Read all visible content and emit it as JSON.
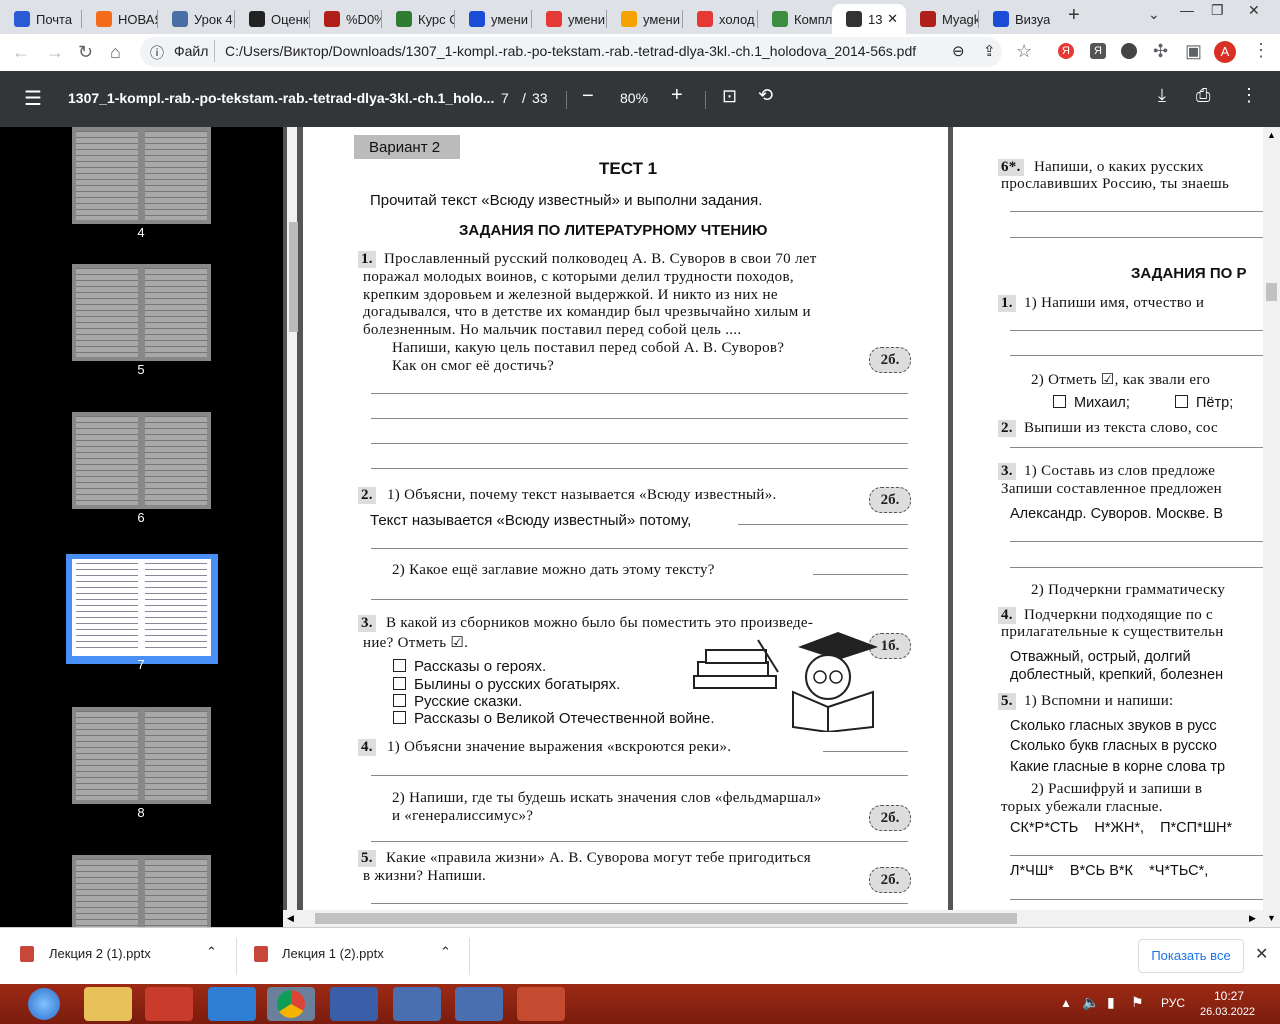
{
  "tabs": [
    {
      "title": "Почта",
      "color": "#2a5bd7",
      "icon": "mail-icon"
    },
    {
      "title": "НОВАЯ",
      "color": "#f66b1c",
      "icon": "site-icon"
    },
    {
      "title": "Урок 4",
      "color": "#4a6fa5",
      "icon": "site-icon"
    },
    {
      "title": "Оценк",
      "color": "#222222",
      "icon": "site-icon"
    },
    {
      "title": "%D0%",
      "color": "#b0201b",
      "icon": "pdf-icon"
    },
    {
      "title": "Курс С",
      "color": "#2e7d32",
      "icon": "site-icon"
    },
    {
      "title": "умени",
      "color": "#1a4cd6",
      "icon": "search-icon"
    },
    {
      "title": "умени",
      "color": "#e53935",
      "icon": "yandex-icon"
    },
    {
      "title": "умени",
      "color": "#f4a300",
      "icon": "image-icon"
    },
    {
      "title": "холод",
      "color": "#e53935",
      "icon": "yandex-icon"
    },
    {
      "title": "Компл",
      "color": "#3e8e41",
      "icon": "book-icon"
    },
    {
      "title": "13",
      "color": "#333333",
      "icon": "globe-icon",
      "active": true
    },
    {
      "title": "Myagk",
      "color": "#b0201b",
      "icon": "pdf-icon"
    },
    {
      "title": "Визуа",
      "color": "#1a4cd6",
      "icon": "site-icon"
    }
  ],
  "address": {
    "scheme": "Файл",
    "url": "C:/Users/Виктор/Downloads/1307_1-kompl.-rab.-po-tekstam.-rab.-tetrad-dlya-3kl.-ch.1_holodova_2014-56s.pdf",
    "avatar": "A"
  },
  "pdf": {
    "title": "1307_1-kompl.-rab.-po-tekstam.-rab.-tetrad-dlya-3kl.-ch.1_holo...",
    "page": "7",
    "page_sep": "/",
    "total": "33",
    "zoom": "80%"
  },
  "thumbs": [
    {
      "num": "4"
    },
    {
      "num": "5"
    },
    {
      "num": "6"
    },
    {
      "num": "7",
      "selected": true
    },
    {
      "num": "8"
    },
    {
      "num": ""
    }
  ],
  "page1": {
    "variant": "Вариант 2",
    "test": "ТЕСТ 1",
    "intro": "Прочитай текст «Всюду известный» и выполни задания.",
    "section": "ЗАДАНИЯ ПО ЛИТЕРАТУРНОМУ ЧТЕНИЮ",
    "q1_num": "1.",
    "q1_lines": [
      "Прославленный русский полководец А. В. Суворов в свои 70 лет",
      "поражал молодых воинов, с которыми делил трудности походов,",
      "крепким здоровьем и железной выдержкой. И никто из них не",
      "догадывался, что в детстве их командир был чрезвычайно хилым и",
      "болезненным. Но мальчик поставил перед собой цель ...."
    ],
    "q1_task": [
      "Напиши, какую цель поставил перед собой А. В. Суворов?",
      "Как он смог её достичь?"
    ],
    "q1_pts": "2б.",
    "q2_num": "2.",
    "q2_a": "1) Объясни, почему текст называется «Всюду известный».",
    "q2_pts": "2б.",
    "q2_ans": "Текст называется «Всюду известный» потому,",
    "q2_b": "2) Какое ещё заглавие можно дать этому тексту?",
    "q3_num": "3.",
    "q3_lines": [
      "В какой из сборников можно было бы поместить это произведе-",
      "ние? Отметь ☑."
    ],
    "q3_pts": "1б.",
    "q3_options": [
      "Рассказы о героях.",
      "Былины о русских богатырях.",
      "Русские сказки.",
      "Рассказы о Великой Отечественной войне."
    ],
    "q4_num": "4.",
    "q4_a": "1) Объясни значение выражения «вскроются реки».",
    "q4_b": [
      "2) Напиши, где ты будешь искать значения слов «фельдмаршал»",
      "и «генералиссимус»?"
    ],
    "q4_pts": "2б.",
    "q5_num": "5.",
    "q5_lines": [
      "Какие «правила жизни» А. В. Суворова могут тебе пригодиться",
      "в жизни? Напиши."
    ],
    "q5_pts": "2б."
  },
  "page2": {
    "q6_num": "6*.",
    "q6_lines": [
      "Напиши, о каких русских",
      "прославивших Россию, ты знаешь"
    ],
    "section": "ЗАДАНИЯ ПО Р",
    "q1": "1) Напиши имя, отчество и",
    "q1_b": "2) Отметь ☑, как звали его",
    "q1_opts": [
      "Михаил;",
      "Пётр;"
    ],
    "q2": "Выпиши из текста слово, сос",
    "q3": [
      "1) Составь из слов предложе",
      "Запиши составленное предложен"
    ],
    "q3_words": "Александр. Суворов. Москве. В",
    "q3_b": "2) Подчеркни грамматическу",
    "q4": [
      "Подчеркни подходящие по с",
      "прилагательные к существительн"
    ],
    "q4_words": [
      "Отважный, острый, долгий",
      "доблестный, крепкий, болезнен"
    ],
    "q5": "1) Вспомни и напиши:",
    "q5_lines": [
      "Сколько гласных звуков в русс",
      "Сколько букв гласных в русско",
      "Какие гласные в корне слова тр"
    ],
    "q5_b": [
      "2) Расшифруй и запиши в",
      "торых убежали гласные."
    ],
    "q5_words1": "СК*Р*СТЬ    Н*ЖН*,    П*СП*ШН*",
    "q5_words2": "Л*ЧШ*    В*СЬ В*К    *Ч*ТЬС*,"
  },
  "downloads": [
    {
      "name": "Лекция 2 (1).pptx"
    },
    {
      "name": "Лекция 1 (2).pptx"
    }
  ],
  "show_all": "Показать все",
  "taskbar": {
    "lang": "РУС",
    "time": "10:27",
    "date": "26.03.2022"
  }
}
